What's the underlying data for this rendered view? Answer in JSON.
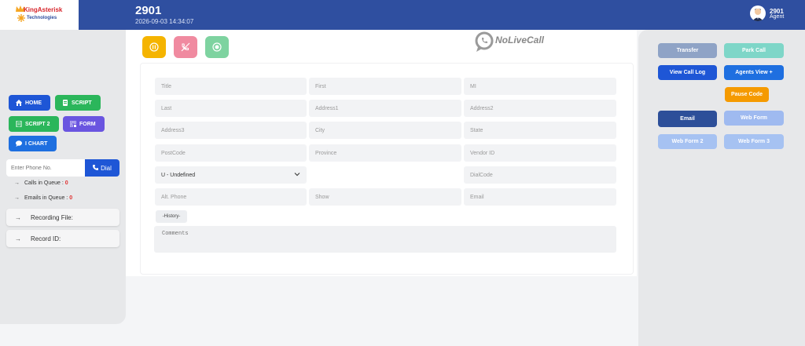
{
  "header": {
    "logo_text": "KingAsterisk",
    "logo_sub": "Technologies",
    "extension": "2901",
    "datetime": "2026-09-03 14:34:07",
    "agent_ext": "2901",
    "agent_role": "Agent"
  },
  "call_controls": [
    {
      "icon": "pause-icon",
      "color": "#f5b400"
    },
    {
      "icon": "hangup-icon",
      "color": "#f08aa0"
    },
    {
      "icon": "record-icon",
      "color": "#7ed3a0"
    }
  ],
  "brand": {
    "text": "NoLiveCall"
  },
  "left_nav": {
    "home": "HOME",
    "script": "SCRIPT",
    "script2": "SCRIPT 2",
    "form": "FORM",
    "ichart": "I CHART",
    "colors": {
      "home": "#1e56d6",
      "script": "#2bb65b",
      "script2": "#2bb65b",
      "form": "#6a55e0",
      "ichart": "#1e6fe0"
    }
  },
  "phone": {
    "placeholder": "Enter Phone No.",
    "dial_label": "Dial"
  },
  "queue": {
    "calls_label": "Calls in Queue :",
    "calls_value": "0",
    "emails_label": "Emails in Queue :",
    "emails_value": "0"
  },
  "info": {
    "recording": "Recording File:",
    "record_id": "Record ID:"
  },
  "form": {
    "title": "Title",
    "first": "First",
    "mi": "MI",
    "last": "Last",
    "address1": "Address1",
    "address2": "Address2",
    "address3": "Address3",
    "city": "City",
    "state": "State",
    "postcode": "PostCode",
    "province": "Province",
    "vendor_id": "Vendor ID",
    "gender_selected": "U - Undefined",
    "dialcode": "DialCode",
    "alt_phone": "Alt. Phone",
    "show": "Show",
    "email": "Email",
    "history": "-History-",
    "comments_placeholder": "Comments"
  },
  "right_buttons": {
    "transfer": "Transfer",
    "park_call": "Park Call",
    "view_call_log": "View Call Log",
    "agents_view": "Agents View +",
    "pause_code": "Pause Code",
    "email": "Email",
    "web_form": "Web Form",
    "web_form_2": "Web Form 2",
    "web_form_3": "Web Form 3"
  }
}
